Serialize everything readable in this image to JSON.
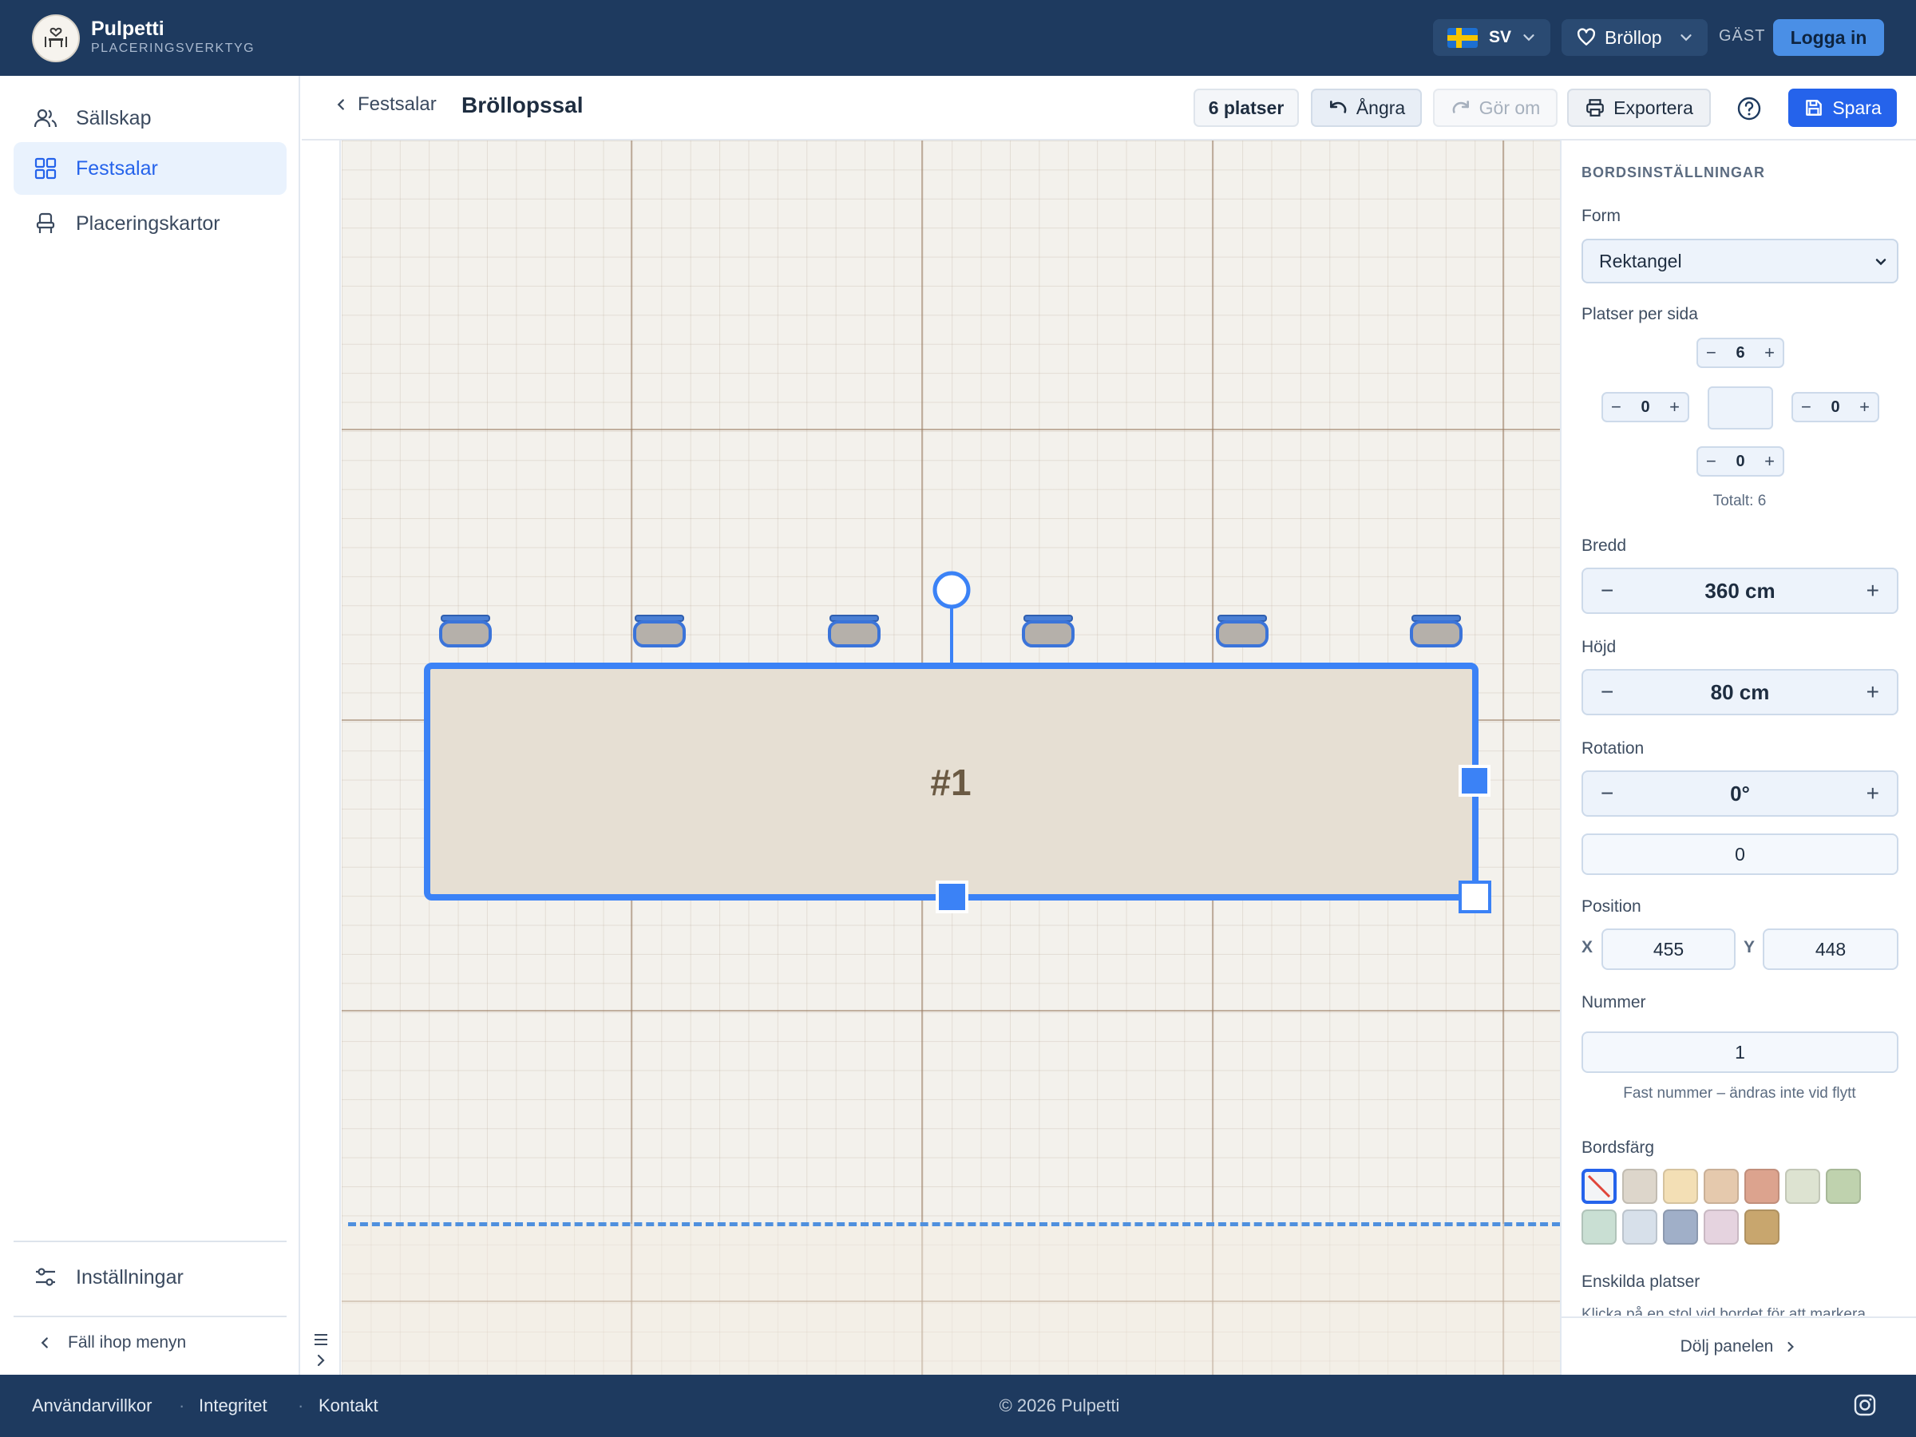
{
  "header": {
    "brand_name": "Pulpetti",
    "brand_subtitle": "PLACERINGSVERKTYG",
    "language_code": "SV",
    "event_label": "Bröllop",
    "guest_label": "GÄST",
    "login_label": "Logga in"
  },
  "sidebar": {
    "items": [
      {
        "label": "Sällskap",
        "icon": "users-icon"
      },
      {
        "label": "Festsalar",
        "icon": "grid-icon",
        "active": true
      },
      {
        "label": "Placeringskartor",
        "icon": "chair-icon"
      }
    ],
    "settings_label": "Inställningar",
    "collapse_label": "Fäll ihop menyn"
  },
  "toolbar": {
    "back_label": "Festsalar",
    "title": "Bröllopssal",
    "seats_badge": "6 platser",
    "undo_label": "Ångra",
    "redo_label": "Gör om",
    "export_label": "Exportera",
    "save_label": "Spara"
  },
  "canvas": {
    "table_label": "#1",
    "chair_count": 6
  },
  "panel": {
    "title": "BORDSINSTÄLLNINGAR",
    "form_label": "Form",
    "form_value": "Rektangel",
    "seats_per_side_label": "Platser per sida",
    "seats": {
      "top": "6",
      "left": "0",
      "right": "0",
      "bottom": "0"
    },
    "total_label": "Totalt: 6",
    "width_label": "Bredd",
    "width_value": "360 cm",
    "height_label": "Höjd",
    "height_value": "80 cm",
    "rotation_label": "Rotation",
    "rotation_value": "0°",
    "rotation_input": "0",
    "position_label": "Position",
    "x_label": "X",
    "x_value": "455",
    "y_label": "Y",
    "y_value": "448",
    "number_label": "Nummer",
    "number_value": "1",
    "number_hint": "Fast nummer – ändras inte vid flytt",
    "color_label": "Bordsfärg",
    "colors": [
      "none",
      "#ddd6cb",
      "#f3dfb5",
      "#e5c9ad",
      "#dca38e",
      "#dde3d1",
      "#bfd2ae",
      "#c9dfd3",
      "#d7e0ea",
      "#a0afc8",
      "#e5d3df",
      "#c8a66e"
    ],
    "individual_label": "Enskilda platser",
    "individual_hint": "Klicka på en stol vid bordet för att markera",
    "hide_panel_label": "Dölj panelen"
  },
  "footer": {
    "links": [
      "Användarvillkor",
      "Integritet",
      "Kontakt"
    ],
    "copyright": "© 2026 Pulpetti"
  },
  "colors": {
    "header_bg": "#1e3a5f",
    "accent": "#2563eb",
    "selection": "#3b82f6",
    "table_fill": "#e6dfd3"
  }
}
